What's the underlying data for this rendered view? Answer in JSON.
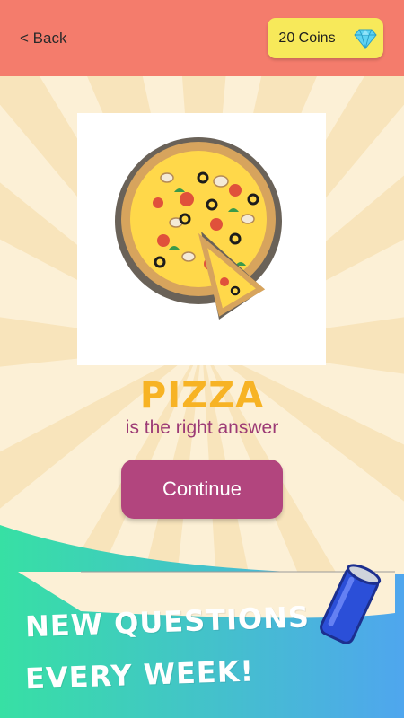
{
  "header": {
    "back_label": "< Back",
    "coins_label": "20 Coins",
    "gem_icon": "diamond-icon",
    "color": "#f47c6c"
  },
  "quiz": {
    "image_icon": "pizza-illustration",
    "answer": "PIZZA",
    "subtitle": "is the right answer",
    "continue_label": "Continue"
  },
  "promo": {
    "line1": "NEW QUESTIONS",
    "line2": "EVERY WEEK!",
    "can_icon": "soda-can-icon"
  },
  "colors": {
    "background": "#fcf0d6",
    "answer": "#f7b324",
    "subtitle": "#9c3a75",
    "button": "#b2457e",
    "coins_badge": "#f7e95a"
  }
}
